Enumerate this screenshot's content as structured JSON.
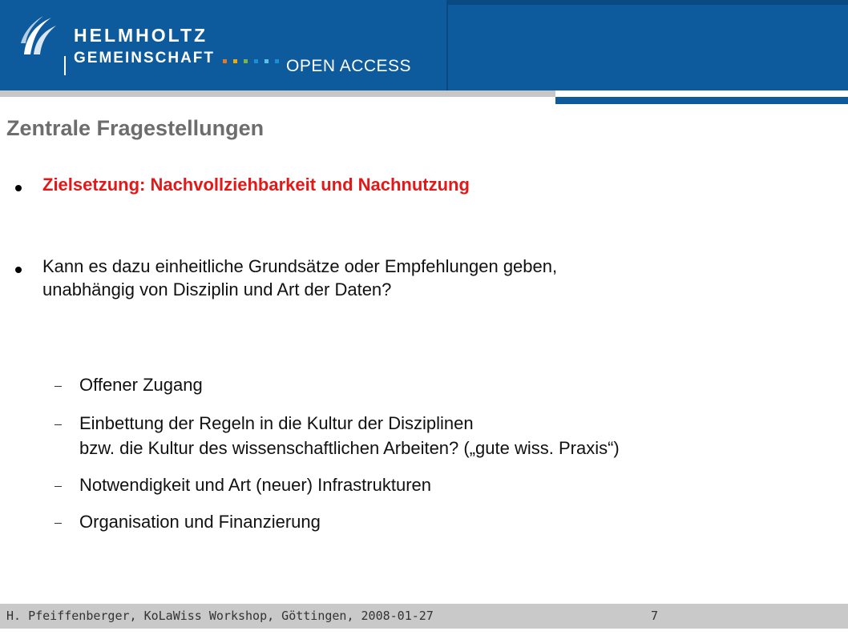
{
  "header": {
    "logo_line1": "HELMHOLTZ",
    "logo_line2": "GEMEINSCHAFT",
    "open_access": "OPEN ACCESS",
    "brand_blue": "#0d5b9c",
    "dot_colors": [
      "#e87722",
      "#f2a900",
      "#7ab648",
      "#1a8fd6",
      "#5bc2e7",
      "#1a8fd6"
    ]
  },
  "slide": {
    "title": "Zentrale Fragestellungen",
    "bullets": [
      {
        "line1": "Zielsetzung: Nachvollziehbarkeit und Nachnutzung",
        "color": "#e31818"
      },
      {
        "line1": "Kann es dazu einheitliche Grundsätze oder Empfehlungen geben,",
        "line2": "unabhängig von Disziplin und Art der Daten?"
      }
    ],
    "subitems": [
      {
        "line1": "Offener Zugang"
      },
      {
        "line1": "Einbettung der Regeln in die Kultur der Disziplinen",
        "line2": "bzw. die Kultur des wissenschaftlichen Arbeiten?   („gute wiss. Praxis“)"
      },
      {
        "line1": "Notwendigkeit und Art (neuer) Infrastrukturen"
      },
      {
        "line1": "Organisation und Finanzierung"
      }
    ]
  },
  "footer": {
    "text": "H. Pfeiffenberger, KoLaWiss Workshop, Göttingen, 2008-01-27",
    "page": "7"
  }
}
